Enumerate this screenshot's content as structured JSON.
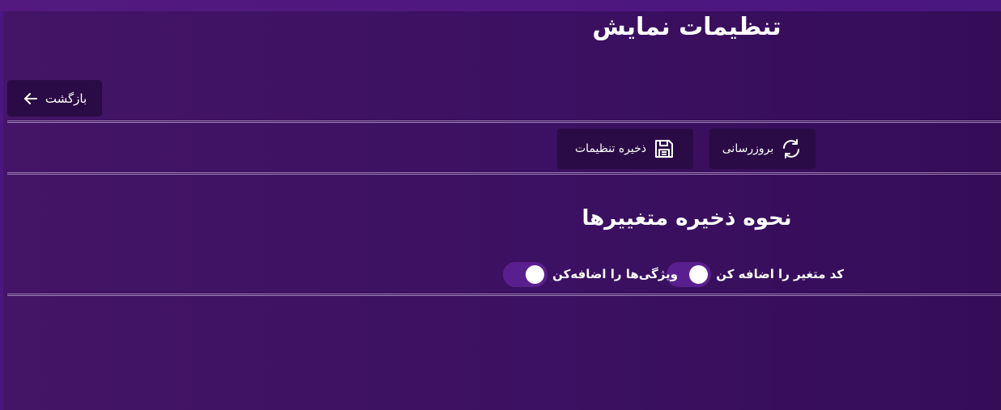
{
  "header": {
    "title": "تنظیمات نمایش",
    "back_label": "بازگشت",
    "back_icon": "arrow-left-icon"
  },
  "toolbar": {
    "refresh_label": "بروزرسانی",
    "refresh_icon": "refresh-icon",
    "save_label": "ذخیره تنظیمات",
    "save_icon": "floppy-disk-icon"
  },
  "section": {
    "title": "نحوه ذخیره متغییرها",
    "toggles": [
      {
        "label": "کد متغیر را اضافه کن",
        "checked": true
      },
      {
        "label": "ویژگی‌ها را اضافه‌کن",
        "checked": true
      }
    ]
  },
  "colors": {
    "background": "#3c1062",
    "button": "#2b0b45",
    "switch_track": "#5a1f8e",
    "text": "#ffffff"
  }
}
